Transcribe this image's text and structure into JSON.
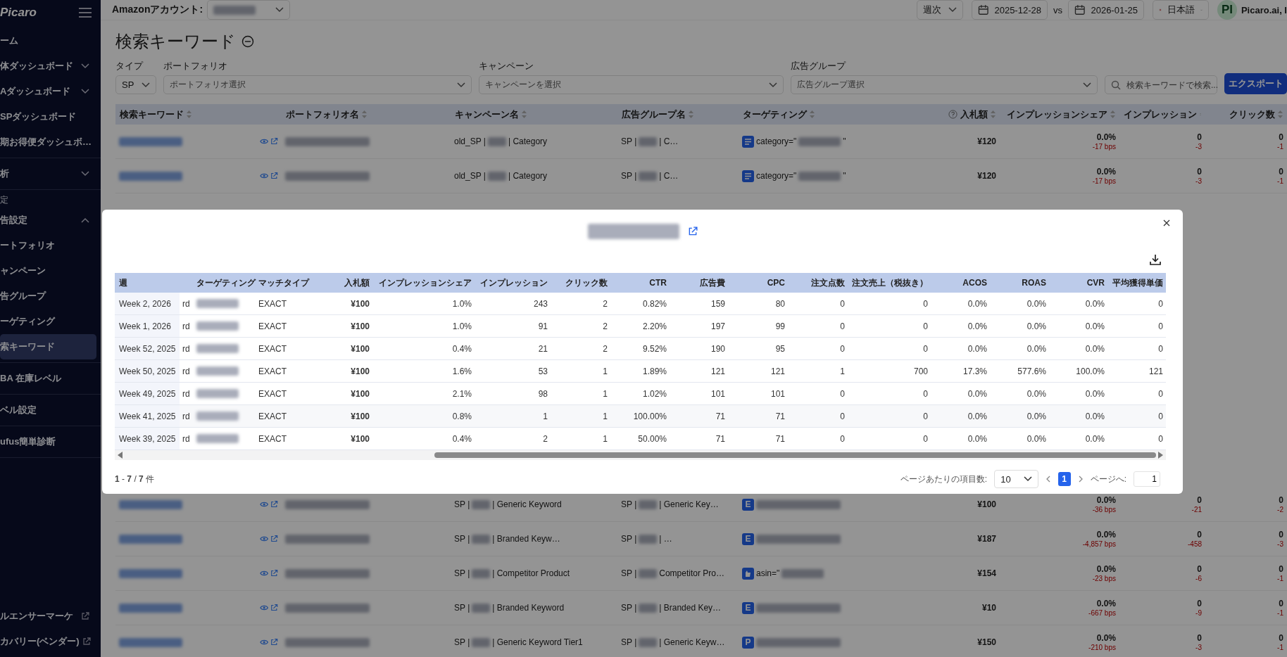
{
  "sidebar": {
    "logo": "Picaro",
    "groups": [
      {
        "items": [
          {
            "label": "ーム",
            "selected": false
          },
          {
            "label": "体ダッシュボード",
            "selected": false,
            "expanded": false
          },
          {
            "label": "Aダッシュボード",
            "selected": false,
            "expanded": false
          },
          {
            "label": "SPダッシュボード",
            "selected": false
          },
          {
            "label": "期お得便ダッシュボ…",
            "selected": false
          }
        ]
      },
      {
        "items": [
          {
            "label": "析",
            "selected": false,
            "expanded": false
          }
        ]
      },
      {
        "label": "定",
        "items": [
          {
            "label": "告設定",
            "selected": false,
            "expanded": true
          },
          {
            "label": "ートフォリオ",
            "selected": false
          },
          {
            "label": "ャンペーン",
            "selected": false
          },
          {
            "label": "告グループ",
            "selected": false
          },
          {
            "label": "ーゲティング",
            "selected": false
          },
          {
            "label": "索キーワード",
            "selected": true
          }
        ]
      },
      {
        "items": [
          {
            "label": "BA 在庫レベル",
            "selected": false
          }
        ]
      },
      {
        "items": [
          {
            "label": "ベル設定",
            "selected": false
          }
        ]
      },
      {
        "items": [
          {
            "label": "ufus簡単診断",
            "selected": false
          }
        ]
      }
    ],
    "bottom_items": [
      {
        "label": "ルエンサーマーケ",
        "external": true
      },
      {
        "label": "カバリー(ベンダー)",
        "external": true
      }
    ]
  },
  "top_bar": {
    "account_label": "Amazonアカウント:",
    "period": "週次",
    "date_from": "2025-12-28",
    "vs": "vs",
    "date_to": "2026-01-25",
    "language": "日本語",
    "avatar": "PI",
    "user": "Picaro.ai, I"
  },
  "page": {
    "title": "検索キーワード",
    "filters": [
      {
        "label": "タイプ",
        "value": "SP"
      },
      {
        "label": "ポートフォリオ",
        "placeholder": "ポートフォリオ選択"
      },
      {
        "label": "キャンペーン",
        "placeholder": "キャンペーンを選択"
      },
      {
        "label": "広告グループ",
        "placeholder": "広告グループ選択"
      }
    ],
    "search": {
      "placeholder": "検索キーワードで検索..."
    },
    "export_button": "エクスポート"
  },
  "table": {
    "columns": [
      "検索キーワード",
      "ポートフォリオ名",
      "キャンペーン名",
      "広告グループ名",
      "ターゲティング",
      "入札額",
      "インプレッションシェア",
      "インプレッション",
      "クリック数"
    ],
    "rows": [
      {
        "campaign": [
          "old_SP |",
          "| Category"
        ],
        "ad_group": [
          "SP |",
          "| C…"
        ],
        "targeting_icon": {
          "kind": "category"
        },
        "targeting": [
          "category=\"",
          "\""
        ],
        "bid": "¥120",
        "impression_share": "0.0%",
        "impression_share_change": "-17 bps",
        "impressions": "0",
        "impressions_change": "-3",
        "clicks": "0",
        "clicks_change": "-1"
      },
      {
        "campaign": [
          "old_SP |",
          "| Category"
        ],
        "ad_group": [
          "SP |",
          "| C…"
        ],
        "targeting_icon": {
          "kind": "category"
        },
        "targeting": [
          "category=\"",
          "\""
        ],
        "bid": "¥120",
        "impression_share": "0.0%",
        "impression_share_change": "-17 bps",
        "impressions": "0",
        "impressions_change": "-3",
        "clicks": "0",
        "clicks_change": "-1"
      }
    ],
    "rows_below": [
      {
        "campaign": [
          "SP |",
          "| Generic Keyword"
        ],
        "ad_group": [
          "SP |",
          "| Generic Key…"
        ],
        "targeting_icon": {
          "kind": "letter",
          "text": "E"
        },
        "bid": "¥100",
        "impression_share": "0.0%",
        "impression_share_change": "-36 bps",
        "impressions": "0",
        "impressions_change": "-21",
        "clicks": "0",
        "clicks_change": "-2"
      },
      {
        "campaign": [
          "SP |",
          "| Branded Keyw…"
        ],
        "ad_group": [
          "SP |",
          "| …"
        ],
        "targeting_icon": {
          "kind": "letter",
          "text": "E"
        },
        "bid": "¥187",
        "impression_share": "0.0%",
        "impression_share_change": "-4,857 bps",
        "impressions": "0",
        "impressions_change": "-458",
        "clicks": "0",
        "clicks_change": "-3"
      },
      {
        "campaign": [
          "SP |",
          "| Competitor Product"
        ],
        "ad_group": [
          "SP |",
          "Competitor Pro…"
        ],
        "targeting_icon": {
          "kind": "product"
        },
        "targeting": [
          "asin=\""
        ],
        "bid": "¥154",
        "impression_share": "0.0%",
        "impression_share_change": "-23 bps",
        "impressions": "0",
        "impressions_change": "-6",
        "clicks": "0",
        "clicks_change": "-1"
      },
      {
        "campaign": [
          "SP |",
          "| Branded Keyword"
        ],
        "ad_group": [
          "SP |",
          "| Branded Key…"
        ],
        "targeting_icon": {
          "kind": "letter",
          "text": "E"
        },
        "bid": "¥10",
        "impression_share": "0.0%",
        "impression_share_change": "-667 bps",
        "impressions": "0",
        "impressions_change": "-9",
        "clicks": "0",
        "clicks_change": "-1"
      },
      {
        "campaign": [
          "SP |",
          "| Generic Keyword Tier1"
        ],
        "ad_group": [
          "SP |",
          "| Generic Keyw…"
        ],
        "targeting_icon": {
          "kind": "letter",
          "text": "P"
        },
        "bid": "¥150",
        "impression_share": "0.0%",
        "impression_share_change": "-210 bps",
        "impressions": "0",
        "impressions_change": "-3",
        "clicks": "0",
        "clicks_change": "-1"
      }
    ]
  },
  "modal": {
    "columns": [
      "週",
      "ターゲティング",
      "マッチタイプ",
      "入札額",
      "インプレッションシェア",
      "インプレッション",
      "クリック数",
      "CTR",
      "広告費",
      "CPC",
      "注文点数",
      "注文売上（税抜き）",
      "ACOS",
      "ROAS",
      "CVR",
      "平均獲得単価"
    ],
    "rows": [
      {
        "week": "Week 2, 2026",
        "column_2": "rd",
        "values": [
          "EXACT",
          "¥100",
          "1.0%",
          "243",
          "2",
          "0.82%",
          "159",
          "80",
          "0",
          "0",
          "0.0%",
          "0.0%",
          "0.0%",
          "0"
        ]
      },
      {
        "week": "Week 1, 2026",
        "column_2": "rd",
        "values": [
          "EXACT",
          "¥100",
          "1.0%",
          "91",
          "2",
          "2.20%",
          "197",
          "99",
          "0",
          "0",
          "0.0%",
          "0.0%",
          "0.0%",
          "0"
        ]
      },
      {
        "week": "Week 52, 2025",
        "column_2": "rd",
        "values": [
          "EXACT",
          "¥100",
          "0.4%",
          "21",
          "2",
          "9.52%",
          "190",
          "95",
          "0",
          "0",
          "0.0%",
          "0.0%",
          "0.0%",
          "0"
        ]
      },
      {
        "week": "Week 50, 2025",
        "column_2": "rd",
        "values": [
          "EXACT",
          "¥100",
          "1.6%",
          "53",
          "1",
          "1.89%",
          "121",
          "121",
          "1",
          "700",
          "17.3%",
          "577.6%",
          "100.0%",
          "121"
        ]
      },
      {
        "week": "Week 49, 2025",
        "column_2": "rd",
        "values": [
          "EXACT",
          "¥100",
          "2.1%",
          "98",
          "1",
          "1.02%",
          "101",
          "101",
          "0",
          "0",
          "0.0%",
          "0.0%",
          "0.0%",
          "0"
        ]
      },
      {
        "week": "Week 41, 2025",
        "column_2": "rd",
        "values": [
          "EXACT",
          "¥100",
          "0.8%",
          "1",
          "1",
          "100.00%",
          "71",
          "71",
          "0",
          "0",
          "0.0%",
          "0.0%",
          "0.0%",
          "0"
        ]
      },
      {
        "week": "Week 39, 2025",
        "column_2": "rd",
        "values": [
          "EXACT",
          "¥100",
          "0.4%",
          "2",
          "1",
          "50.00%",
          "71",
          "71",
          "0",
          "0",
          "0.0%",
          "0.0%",
          "0.0%",
          "0"
        ]
      }
    ],
    "count": "**1** - **7** / **7** 件",
    "per_page_label": "ページあたりの項目数:",
    "per_page": "10",
    "pages": [
      {
        "label": "1",
        "selected": true
      }
    ],
    "goto_label": "ページへ:",
    "goto_value": "1"
  }
}
